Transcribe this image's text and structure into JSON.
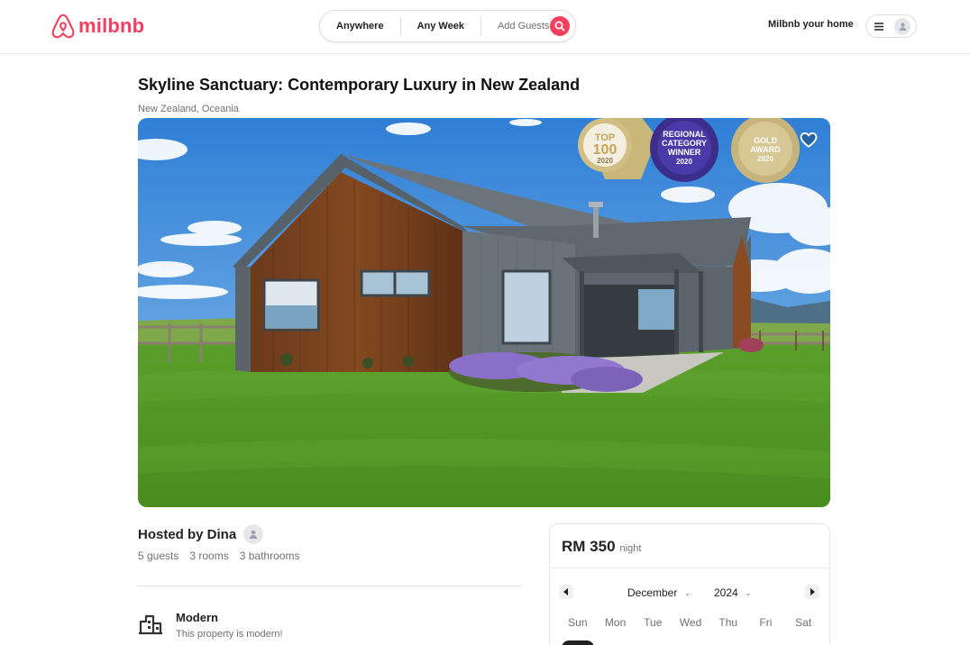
{
  "header": {
    "brand": "milbnb",
    "search": {
      "where": "Anywhere",
      "when": "Any Week",
      "who": "Add Guests"
    },
    "host_link": "Milbnb your home"
  },
  "listing": {
    "title": "Skyline Sanctuary: Contemporary Luxury in New Zealand",
    "location": "New Zealand, Oceania",
    "badges": [
      {
        "line1": "TOP",
        "line2": "100",
        "year": "2020"
      },
      {
        "line1": "REGIONAL",
        "line2": "CATEGORY",
        "line3": "WINNER",
        "year": "2020"
      },
      {
        "line1": "GOLD",
        "line2": "AWARD",
        "year": "2020"
      }
    ],
    "host": "Hosted by Dina",
    "guests": "5 guests",
    "rooms": "3 rooms",
    "bathrooms": "3 bathrooms",
    "feature": {
      "title": "Modern",
      "description": "This property is modern!"
    }
  },
  "booking": {
    "price": "RM 350",
    "unit": "night",
    "month": "December",
    "year": "2024",
    "weekdays": [
      "Sun",
      "Mon",
      "Tue",
      "Wed",
      "Thu",
      "Fri",
      "Sat"
    ]
  },
  "colors": {
    "brand": "#f43f5e",
    "text": "#222222",
    "muted": "#717171"
  }
}
